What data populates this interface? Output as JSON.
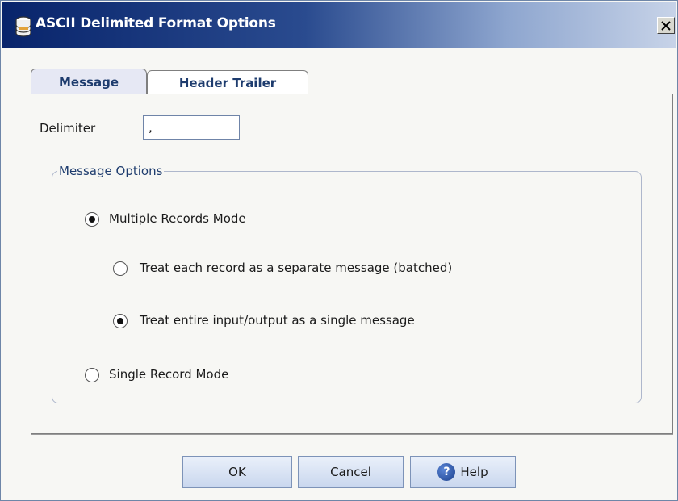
{
  "window": {
    "title": "ASCII Delimited Format Options",
    "close_glyph": "✕",
    "title_icon": "database-icon"
  },
  "tabs": [
    {
      "label": "Message",
      "selected": true
    },
    {
      "label": "Header Trailer",
      "selected": false
    }
  ],
  "delimiter": {
    "label": "Delimiter",
    "value": ","
  },
  "message_options": {
    "legend": "Message Options",
    "multiple_records_mode": {
      "label": "Multiple Records Mode",
      "checked": true
    },
    "batched": {
      "label": "Treat each record as a separate message (batched)",
      "checked": false
    },
    "single_message": {
      "label": "Treat entire input/output as a single message",
      "checked": true
    },
    "single_record_mode": {
      "label": "Single Record Mode",
      "checked": false
    }
  },
  "buttons": {
    "ok": "OK",
    "cancel": "Cancel",
    "help": "Help",
    "help_icon_glyph": "?"
  },
  "colors": {
    "title_bar_start": "#08246b",
    "title_bar_end": "#c7d3e8",
    "button_fill": "#c9d7ee",
    "accent_text": "#1e3c6e"
  }
}
